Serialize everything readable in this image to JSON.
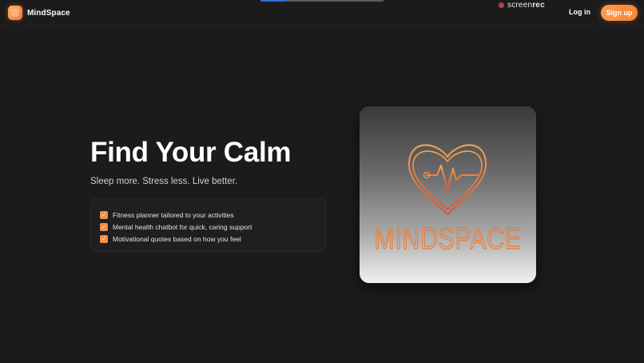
{
  "header": {
    "brand_name": "MindSpace",
    "login_label": "Log in",
    "signup_label": "Sign up"
  },
  "overlay": {
    "recorder_text_light": "screen",
    "recorder_text_bold": "rec",
    "recorder_color": "#c73a3a",
    "progress_fraction": 0.2
  },
  "hero": {
    "title": "Find Your Calm",
    "subtitle": "Sleep more. Stress less. Live better.",
    "features": [
      "Fitness planner tailored to your activities",
      "Mental health chatbot for quick, caring support",
      "Motivational quotes based on how you feel"
    ],
    "check_icon": "checkbox-checked-icon"
  },
  "logo_card": {
    "wordmark": "MINDSPACE",
    "icon": "heart-pulse-icon"
  },
  "colors": {
    "background": "#1b1b1c",
    "accent": "#f58536",
    "accent_light": "#ffb26b",
    "logo_gradient_top": "#f7a84a",
    "logo_gradient_bottom": "#e0502a"
  }
}
